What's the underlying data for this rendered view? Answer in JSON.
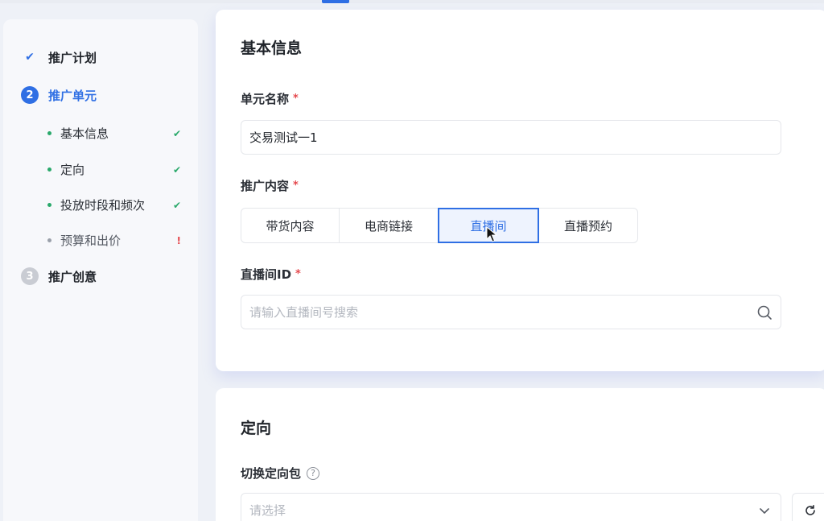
{
  "steps": [
    {
      "label": "推广计划",
      "state": "done",
      "icon": "check-icon"
    },
    {
      "label": "推广单元",
      "state": "active",
      "number": "2"
    },
    {
      "label": "推广创意",
      "state": "pending",
      "number": "3"
    }
  ],
  "substeps": [
    {
      "label": "基本信息",
      "status": "✔"
    },
    {
      "label": "定向",
      "status": "✔"
    },
    {
      "label": "投放时段和频次",
      "status": "✔"
    },
    {
      "label": "预算和出价",
      "status": "!"
    }
  ],
  "basic_info": {
    "title": "基本信息",
    "unit_name_label": "单元名称",
    "unit_name_value": "交易测试一1",
    "content_label": "推广内容",
    "content_tabs": [
      "带货内容",
      "电商链接",
      "直播间",
      "直播预约"
    ],
    "selected_tab": "直播间",
    "room_id_label": "直播间ID",
    "room_id_placeholder": "请输入直播间号搜索"
  },
  "targeting": {
    "title": "定向",
    "package_label": "切换定向包",
    "package_placeholder": "请选择"
  },
  "required_mark": "*",
  "colors": {
    "accent": "#2f6fe4",
    "success": "#2aa96b",
    "error": "#e5484d"
  }
}
